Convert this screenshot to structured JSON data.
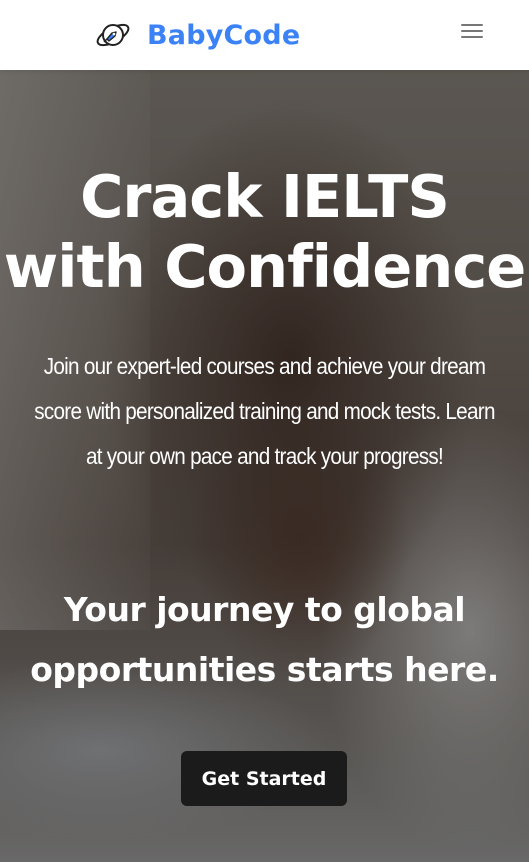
{
  "colors": {
    "brand": "#3b82f6",
    "nav_background": "#ffffff",
    "menu_icon": "#777777",
    "hero_text": "#ffffff",
    "cta_background": "#1b1b1b",
    "cta_text": "#ffffff"
  },
  "header": {
    "brand_name": "BabyCode",
    "logo_icon": "planet-rocket-icon",
    "menu_icon": "hamburger-menu-icon"
  },
  "hero": {
    "title": "Crack IELTS with Confidence",
    "description": "Join our expert-led courses and achieve your dream score with personalized training and mock tests. Learn at your own pace and track your progress!",
    "tagline": "Your journey to global opportunities starts here.",
    "cta_label": "Get Started",
    "background_image": "woman helping child at laptop"
  }
}
